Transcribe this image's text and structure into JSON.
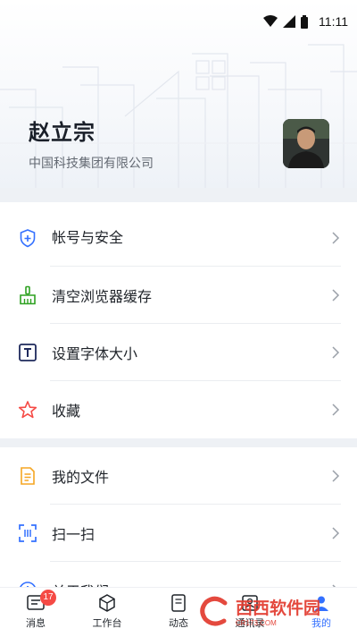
{
  "status_bar": {
    "time": "11:11"
  },
  "profile": {
    "name": "赵立宗",
    "company": "中国科技集团有限公司"
  },
  "settings": [
    {
      "label": "帐号与安全",
      "icon": "shield-plus-icon"
    },
    {
      "label": "清空浏览器缓存",
      "icon": "broom-icon"
    },
    {
      "label": "设置字体大小",
      "icon": "font-size-icon"
    },
    {
      "label": "收藏",
      "icon": "star-icon"
    }
  ],
  "tools": [
    {
      "label": "我的文件",
      "icon": "file-icon"
    },
    {
      "label": "扫一扫",
      "icon": "scan-icon"
    },
    {
      "label": "关于我们",
      "icon": "info-icon"
    }
  ],
  "bottom_nav": {
    "items": [
      {
        "label": "消息",
        "badge": "17"
      },
      {
        "label": "工作台"
      },
      {
        "label": "动态"
      },
      {
        "label": "通讯录"
      },
      {
        "label": "我的"
      }
    ],
    "active_color": "#3370ff"
  },
  "watermark": {
    "title": "西西软件园",
    "subtitle": "CR173.COM"
  },
  "colors": {
    "accent": "#3370ff",
    "star": "#f54a45",
    "broom": "#2ea121",
    "file": "#f5a623",
    "separator": "#eef1f5"
  }
}
